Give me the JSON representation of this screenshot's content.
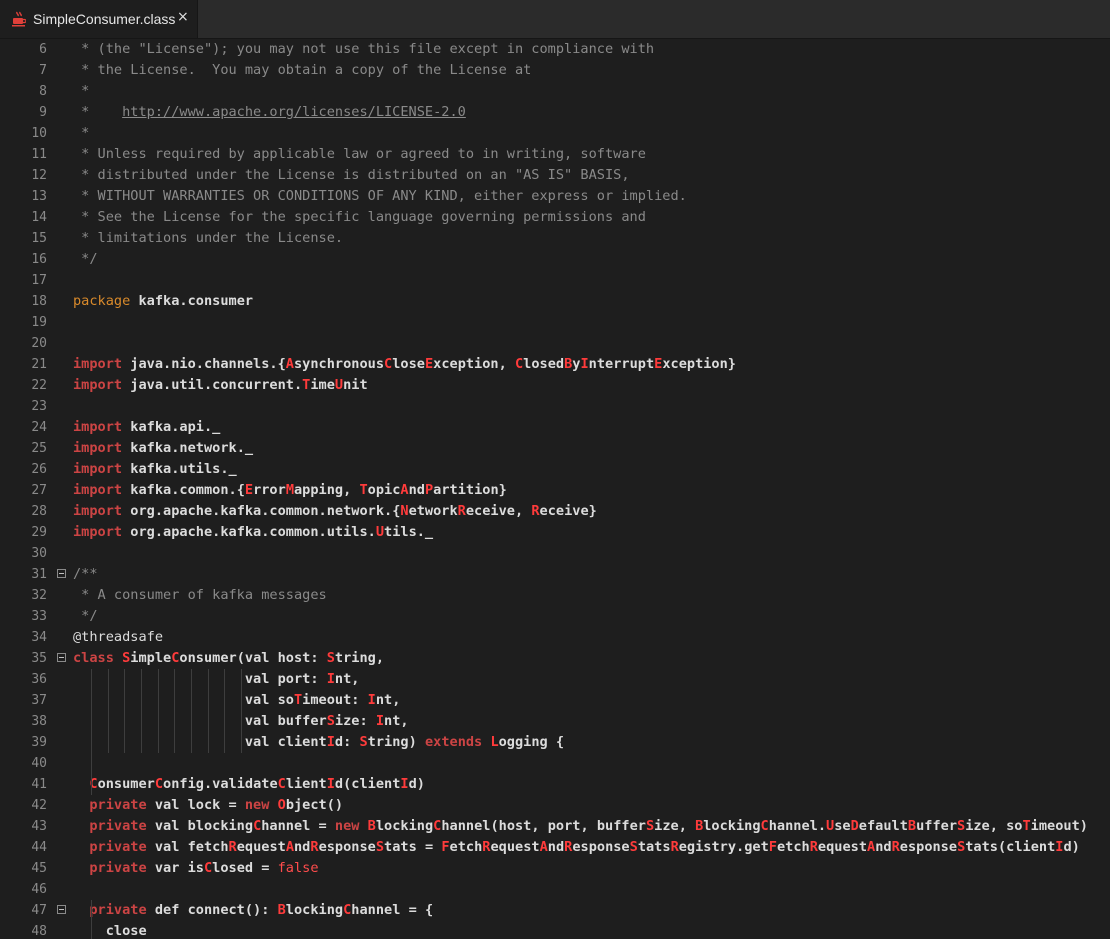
{
  "tab": {
    "title": "SimpleConsumer.class",
    "close": "×"
  },
  "lines": [
    {
      "n": "6",
      "t": [
        [
          "c",
          " * (the \"License\"); you may not use this file except in compliance with"
        ]
      ]
    },
    {
      "n": "7",
      "t": [
        [
          "c",
          " * the License.  You may obtain a copy of the License at"
        ]
      ]
    },
    {
      "n": "8",
      "t": [
        [
          "c",
          " *"
        ]
      ]
    },
    {
      "n": "9",
      "t": [
        [
          "c",
          " *    "
        ],
        [
          "l",
          "http://www.apache.org/licenses/LICENSE-2.0"
        ]
      ]
    },
    {
      "n": "10",
      "t": [
        [
          "c",
          " *"
        ]
      ]
    },
    {
      "n": "11",
      "t": [
        [
          "c",
          " * Unless required by applicable law or agreed to in writing, software"
        ]
      ]
    },
    {
      "n": "12",
      "t": [
        [
          "c",
          " * distributed under the License is distributed on an \"AS IS\" BASIS,"
        ]
      ]
    },
    {
      "n": "13",
      "t": [
        [
          "c",
          " * WITHOUT WARRANTIES OR CONDITIONS OF ANY KIND, either express or implied."
        ]
      ]
    },
    {
      "n": "14",
      "t": [
        [
          "c",
          " * See the License for the specific language governing permissions and"
        ]
      ]
    },
    {
      "n": "15",
      "t": [
        [
          "c",
          " * limitations under the License."
        ]
      ]
    },
    {
      "n": "16",
      "t": [
        [
          "c",
          " */"
        ]
      ]
    },
    {
      "n": "17",
      "t": []
    },
    {
      "n": "18",
      "t": [
        [
          "p",
          "package "
        ],
        [
          "i",
          "kafka.consumer"
        ]
      ]
    },
    {
      "n": "19",
      "t": []
    },
    {
      "n": "20",
      "t": []
    },
    {
      "n": "21",
      "t": [
        [
          "k",
          "import "
        ],
        [
          "i",
          "java.nio.channels.{"
        ],
        [
          "r",
          "A"
        ],
        [
          "i",
          "synchronous"
        ],
        [
          "r",
          "C"
        ],
        [
          "i",
          "lose"
        ],
        [
          "r",
          "E"
        ],
        [
          "i",
          "xception, "
        ],
        [
          "r",
          "C"
        ],
        [
          "i",
          "losed"
        ],
        [
          "r",
          "B"
        ],
        [
          "i",
          "y"
        ],
        [
          "r",
          "I"
        ],
        [
          "i",
          "nterrupt"
        ],
        [
          "r",
          "E"
        ],
        [
          "i",
          "xception}"
        ]
      ]
    },
    {
      "n": "22",
      "t": [
        [
          "k",
          "import "
        ],
        [
          "i",
          "java.util.concurrent."
        ],
        [
          "r",
          "T"
        ],
        [
          "i",
          "ime"
        ],
        [
          "r",
          "U"
        ],
        [
          "i",
          "nit"
        ]
      ]
    },
    {
      "n": "23",
      "t": []
    },
    {
      "n": "24",
      "t": [
        [
          "k",
          "import "
        ],
        [
          "i",
          "kafka.api._"
        ]
      ]
    },
    {
      "n": "25",
      "t": [
        [
          "k",
          "import "
        ],
        [
          "i",
          "kafka.network._"
        ]
      ]
    },
    {
      "n": "26",
      "t": [
        [
          "k",
          "import "
        ],
        [
          "i",
          "kafka.utils._"
        ]
      ]
    },
    {
      "n": "27",
      "t": [
        [
          "k",
          "import "
        ],
        [
          "i",
          "kafka.common.{"
        ],
        [
          "r",
          "E"
        ],
        [
          "i",
          "rror"
        ],
        [
          "r",
          "M"
        ],
        [
          "i",
          "apping, "
        ],
        [
          "r",
          "T"
        ],
        [
          "i",
          "opic"
        ],
        [
          "r",
          "A"
        ],
        [
          "i",
          "nd"
        ],
        [
          "r",
          "P"
        ],
        [
          "i",
          "artition}"
        ]
      ]
    },
    {
      "n": "28",
      "t": [
        [
          "k",
          "import "
        ],
        [
          "i",
          "org.apache.kafka.common.network.{"
        ],
        [
          "r",
          "N"
        ],
        [
          "i",
          "etwork"
        ],
        [
          "r",
          "R"
        ],
        [
          "i",
          "eceive, "
        ],
        [
          "r",
          "R"
        ],
        [
          "i",
          "eceive}"
        ]
      ]
    },
    {
      "n": "29",
      "t": [
        [
          "k",
          "import "
        ],
        [
          "i",
          "org.apache.kafka.common.utils."
        ],
        [
          "r",
          "U"
        ],
        [
          "i",
          "tils._"
        ]
      ]
    },
    {
      "n": "30",
      "t": []
    },
    {
      "n": "31",
      "fold": true,
      "t": [
        [
          "c",
          "/**"
        ]
      ]
    },
    {
      "n": "32",
      "t": [
        [
          "c",
          " * A consumer of kafka messages"
        ]
      ]
    },
    {
      "n": "33",
      "t": [
        [
          "c",
          " */"
        ]
      ]
    },
    {
      "n": "34",
      "t": [
        [
          "a",
          "@threadsafe"
        ]
      ]
    },
    {
      "n": "35",
      "fold": true,
      "t": [
        [
          "k",
          "class "
        ],
        [
          "r",
          "S"
        ],
        [
          "i",
          "imple"
        ],
        [
          "r",
          "C"
        ],
        [
          "i",
          "onsumer(val host: "
        ],
        [
          "r",
          "S"
        ],
        [
          "i",
          "tring,"
        ]
      ]
    },
    {
      "n": "36",
      "t": [
        [
          "i",
          "                     val port: "
        ],
        [
          "r",
          "I"
        ],
        [
          "i",
          "nt,"
        ]
      ]
    },
    {
      "n": "37",
      "t": [
        [
          "i",
          "                     val so"
        ],
        [
          "r",
          "T"
        ],
        [
          "i",
          "imeout: "
        ],
        [
          "r",
          "I"
        ],
        [
          "i",
          "nt,"
        ]
      ]
    },
    {
      "n": "38",
      "t": [
        [
          "i",
          "                     val buffer"
        ],
        [
          "r",
          "S"
        ],
        [
          "i",
          "ize: "
        ],
        [
          "r",
          "I"
        ],
        [
          "i",
          "nt,"
        ]
      ]
    },
    {
      "n": "39",
      "t": [
        [
          "i",
          "                     val client"
        ],
        [
          "r",
          "I"
        ],
        [
          "i",
          "d: "
        ],
        [
          "r",
          "S"
        ],
        [
          "i",
          "tring) "
        ],
        [
          "k",
          "extends "
        ],
        [
          "r",
          "L"
        ],
        [
          "i",
          "ogging {"
        ]
      ]
    },
    {
      "n": "40",
      "t": []
    },
    {
      "n": "41",
      "t": [
        [
          "i",
          "  "
        ],
        [
          "r",
          "C"
        ],
        [
          "i",
          "onsumer"
        ],
        [
          "r",
          "C"
        ],
        [
          "i",
          "onfig.validate"
        ],
        [
          "r",
          "C"
        ],
        [
          "i",
          "lient"
        ],
        [
          "r",
          "I"
        ],
        [
          "i",
          "d(client"
        ],
        [
          "r",
          "I"
        ],
        [
          "i",
          "d)"
        ]
      ]
    },
    {
      "n": "42",
      "t": [
        [
          "k",
          "  private "
        ],
        [
          "i",
          "val lock = "
        ],
        [
          "k",
          "new "
        ],
        [
          "r",
          "O"
        ],
        [
          "i",
          "bject()"
        ]
      ]
    },
    {
      "n": "43",
      "t": [
        [
          "k",
          "  private "
        ],
        [
          "i",
          "val blocking"
        ],
        [
          "r",
          "C"
        ],
        [
          "i",
          "hannel = "
        ],
        [
          "k",
          "new "
        ],
        [
          "r",
          "B"
        ],
        [
          "i",
          "locking"
        ],
        [
          "r",
          "C"
        ],
        [
          "i",
          "hannel(host, port, buffer"
        ],
        [
          "r",
          "S"
        ],
        [
          "i",
          "ize, "
        ],
        [
          "r",
          "B"
        ],
        [
          "i",
          "locking"
        ],
        [
          "r",
          "C"
        ],
        [
          "i",
          "hannel."
        ],
        [
          "r",
          "U"
        ],
        [
          "i",
          "se"
        ],
        [
          "r",
          "D"
        ],
        [
          "i",
          "efault"
        ],
        [
          "r",
          "B"
        ],
        [
          "i",
          "uffer"
        ],
        [
          "r",
          "S"
        ],
        [
          "i",
          "ize, so"
        ],
        [
          "r",
          "T"
        ],
        [
          "i",
          "imeout)"
        ]
      ]
    },
    {
      "n": "44",
      "t": [
        [
          "k",
          "  private "
        ],
        [
          "i",
          "val fetch"
        ],
        [
          "r",
          "R"
        ],
        [
          "i",
          "equest"
        ],
        [
          "r",
          "A"
        ],
        [
          "i",
          "nd"
        ],
        [
          "r",
          "R"
        ],
        [
          "i",
          "esponse"
        ],
        [
          "r",
          "S"
        ],
        [
          "i",
          "tats = "
        ],
        [
          "r",
          "F"
        ],
        [
          "i",
          "etch"
        ],
        [
          "r",
          "R"
        ],
        [
          "i",
          "equest"
        ],
        [
          "r",
          "A"
        ],
        [
          "i",
          "nd"
        ],
        [
          "r",
          "R"
        ],
        [
          "i",
          "esponse"
        ],
        [
          "r",
          "S"
        ],
        [
          "i",
          "tats"
        ],
        [
          "r",
          "R"
        ],
        [
          "i",
          "egistry.get"
        ],
        [
          "r",
          "F"
        ],
        [
          "i",
          "etch"
        ],
        [
          "r",
          "R"
        ],
        [
          "i",
          "equest"
        ],
        [
          "r",
          "A"
        ],
        [
          "i",
          "nd"
        ],
        [
          "r",
          "R"
        ],
        [
          "i",
          "esponse"
        ],
        [
          "r",
          "S"
        ],
        [
          "i",
          "tats(client"
        ],
        [
          "r",
          "I"
        ],
        [
          "i",
          "d)"
        ]
      ]
    },
    {
      "n": "45",
      "t": [
        [
          "k",
          "  private "
        ],
        [
          "i",
          "var is"
        ],
        [
          "r",
          "C"
        ],
        [
          "i",
          "losed = "
        ],
        [
          "f",
          "false"
        ]
      ]
    },
    {
      "n": "46",
      "t": []
    },
    {
      "n": "47",
      "fold": true,
      "t": [
        [
          "k",
          "  private "
        ],
        [
          "i",
          "def connect(): "
        ],
        [
          "r",
          "B"
        ],
        [
          "i",
          "locking"
        ],
        [
          "r",
          "C"
        ],
        [
          "i",
          "hannel = {"
        ]
      ]
    },
    {
      "n": "48",
      "t": [
        [
          "i",
          "    close"
        ]
      ]
    }
  ]
}
